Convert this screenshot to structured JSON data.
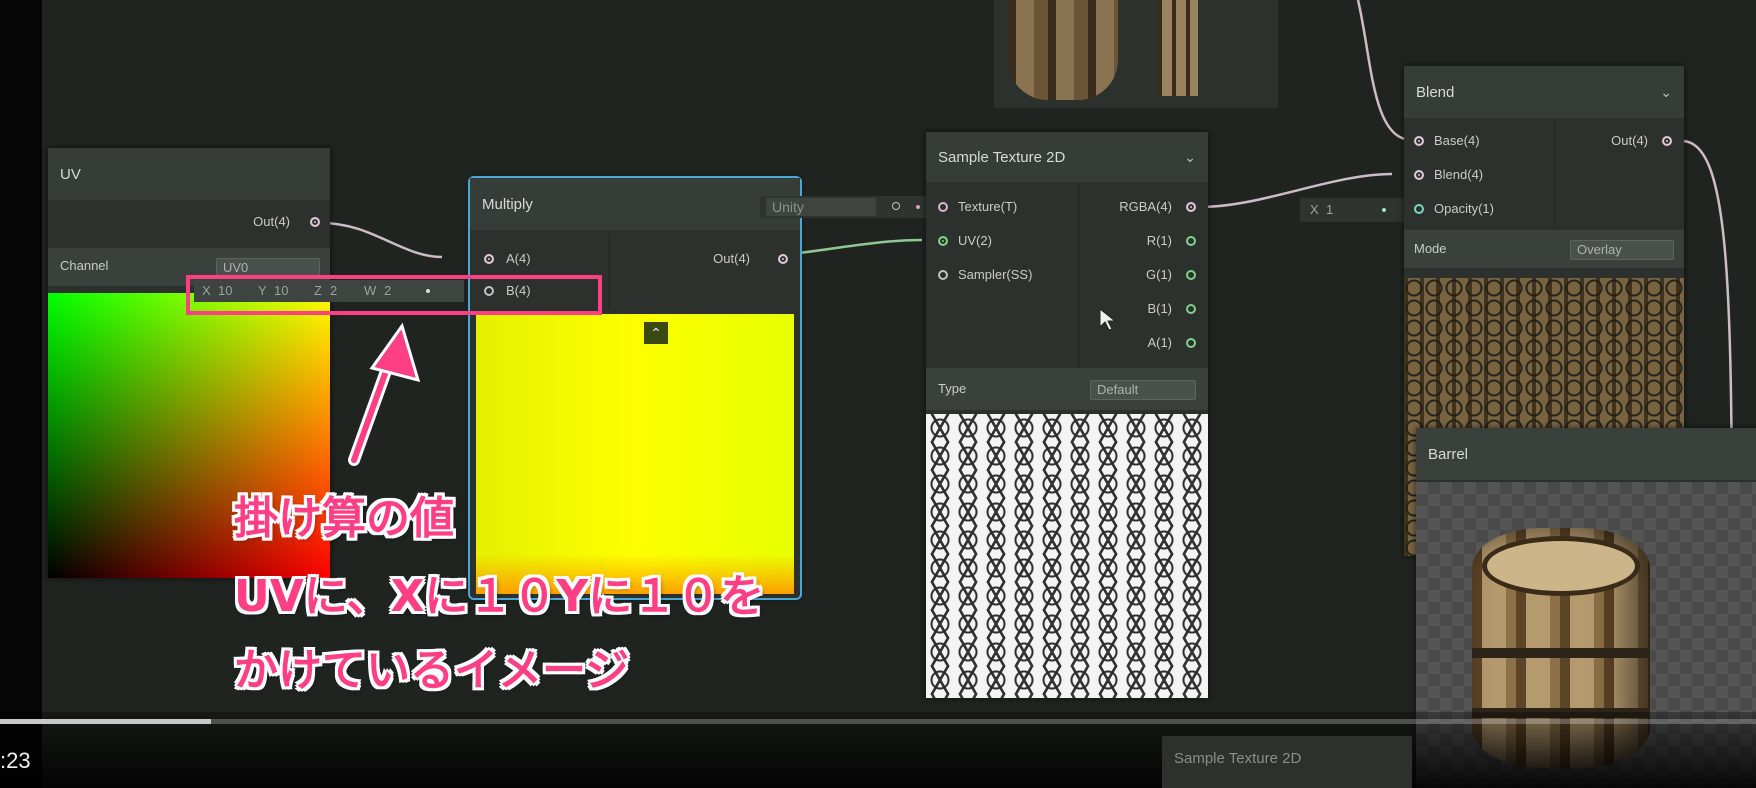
{
  "colors": {
    "graph_bg": "#1f2420",
    "node_bg": "#2c312d",
    "highlight": "#ff3f84",
    "selection": "#4aa8d8"
  },
  "nodes": {
    "uv": {
      "title": "UV",
      "out": "Out(4)",
      "channel_label": "Channel",
      "channel_value": "UV0"
    },
    "multiply": {
      "title": "Multiply",
      "in_a": "A(4)",
      "in_b": "B(4)",
      "out": "Out(4)",
      "b_fields": {
        "x": "X",
        "x_val": "10",
        "y": "Y",
        "y_val": "10",
        "z": "Z",
        "z_val": "2",
        "w": "W",
        "w_val": "2"
      },
      "collapse_icon": "chevron-up-icon"
    },
    "texture_input": {
      "value": "Unity"
    },
    "sample_texture": {
      "title": "Sample Texture 2D",
      "in_texture": "Texture(T)",
      "in_uv": "UV(2)",
      "in_sampler": "Sampler(SS)",
      "out_rgba": "RGBA(4)",
      "out_r": "R(1)",
      "out_g": "G(1)",
      "out_b": "B(1)",
      "out_a": "A(1)",
      "type_label": "Type",
      "type_value": "Default"
    },
    "opacity_input": {
      "label": "X",
      "value": "1"
    },
    "blend": {
      "title": "Blend",
      "in_base": "Base(4)",
      "in_blend": "Blend(4)",
      "in_opacity": "Opacity(1)",
      "out": "Out(4)",
      "mode_label": "Mode",
      "mode_value": "Overlay"
    },
    "barrel": {
      "title": "Barrel"
    },
    "sample_texture_bottom": {
      "title": "Sample Texture 2D"
    }
  },
  "annotation": {
    "line1": "掛け算の値",
    "line2": "UVに、Xに１０Yに１０を",
    "line3": "かけているイメージ"
  },
  "video": {
    "timestamp": ":23",
    "progress": 0.12
  }
}
